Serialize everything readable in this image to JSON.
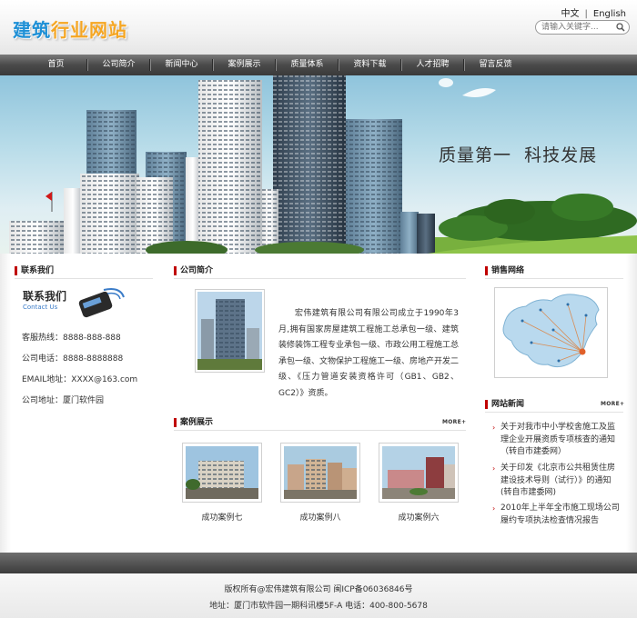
{
  "header": {
    "logo_part1": "建筑",
    "logo_part2": "行业网站",
    "lang_zh": "中文",
    "lang_sep": "|",
    "lang_en": "English",
    "search_placeholder": "请输入关键字..."
  },
  "nav": {
    "items": [
      "首页",
      "公司简介",
      "新闻中心",
      "案例展示",
      "质量体系",
      "资料下载",
      "人才招聘",
      "留言反馈"
    ]
  },
  "banner": {
    "slogan": "质量第一  科技发展"
  },
  "contact": {
    "title": "联系我们",
    "image_cn": "联系我们",
    "image_en": "Contact Us",
    "hotline": "客服热线：8888-888-888",
    "phone": "公司电话：8888-8888888",
    "email": "EMAIL地址：XXXX@163.com",
    "address": "公司地址：厦门软件园"
  },
  "about": {
    "title": "公司简介",
    "text": "宏伟建筑有限公司有限公司成立于1990年3月,拥有国家房屋建筑工程施工总承包一级、建筑装修装饰工程专业承包一级、市政公用工程施工总承包一级、文物保护工程施工一级、房地产开发二级、《压力管道安装资格许可（GB1、GB2、GC2）》资质。"
  },
  "cases": {
    "title": "案例展示",
    "more": "MORE+",
    "items": [
      "成功案例七",
      "成功案例八",
      "成功案例六"
    ]
  },
  "sales": {
    "title": "销售网络"
  },
  "news": {
    "title": "网站新闻",
    "more": "MORE+",
    "items": [
      "关于对我市中小学校舍施工及监理企业开展资质专项核查的通知（转自市建委网）",
      "关于印发《北京市公共租赁住房建设技术导则（试行）》的通知(转自市建委网)",
      "2010年上半年全市施工现场公司履约专项执法检查情况报告"
    ]
  },
  "footer": {
    "copyright": "版权所有@宏伟建筑有限公司  闽ICP备06036846号",
    "address": "地址：厦门市软件园一期科讯楼5F-A  电话：400-800-5678"
  },
  "colors": {
    "accent_red": "#c00000",
    "logo_blue": "#1e90d6",
    "logo_orange": "#f5a623",
    "nav_bg": "#4a4a4a"
  }
}
